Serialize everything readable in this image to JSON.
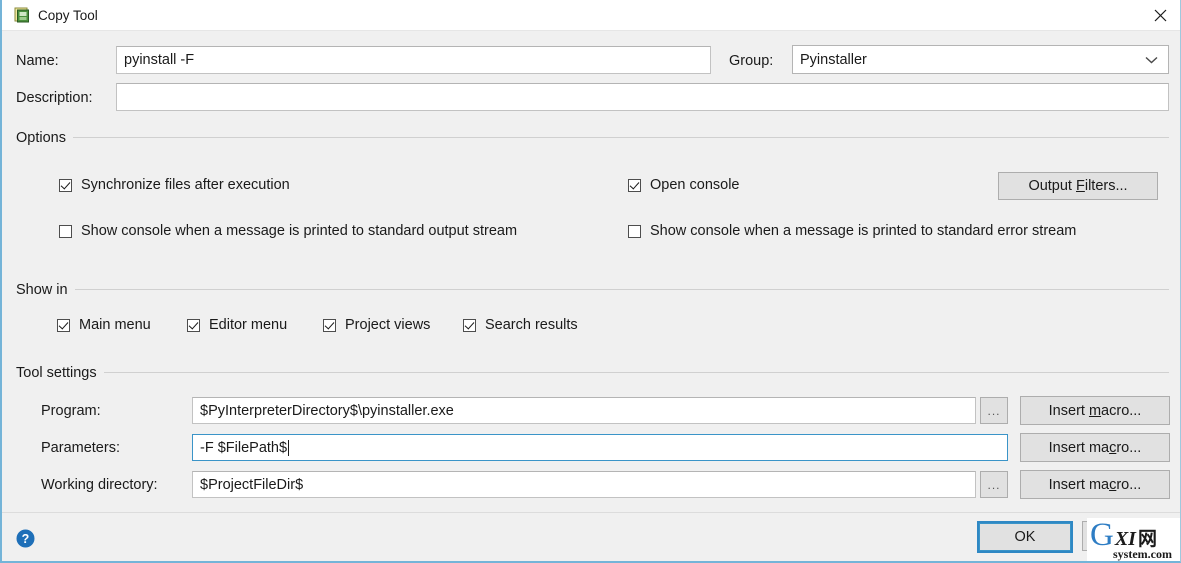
{
  "window": {
    "title": "Copy Tool",
    "icon": "copy-tool-icon",
    "close_label": "✕"
  },
  "form": {
    "name_label": "Name:",
    "name_value": "pyinstall -F",
    "group_label": "Group:",
    "group_value": "Pyinstaller",
    "description_label": "Description:",
    "description_value": ""
  },
  "options": {
    "title": "Options",
    "checkboxes": [
      {
        "label": "Synchronize files after execution",
        "checked": true
      },
      {
        "label": "Open console",
        "checked": true
      },
      {
        "label": "Show console when a message is printed to standard output stream",
        "checked": false
      },
      {
        "label": "Show console when a message is printed to standard error stream",
        "checked": false
      }
    ],
    "output_filters_button": "Output Filters...",
    "output_filters_mnemonic": "F"
  },
  "show_in": {
    "title": "Show in",
    "checkboxes": [
      {
        "label": "Main menu",
        "checked": true
      },
      {
        "label": "Editor menu",
        "checked": true
      },
      {
        "label": "Project views",
        "checked": true
      },
      {
        "label": "Search results",
        "checked": true
      }
    ]
  },
  "tool_settings": {
    "title": "Tool settings",
    "rows": [
      {
        "label": "Program:",
        "value": "$PyInterpreterDirectory$\\pyinstaller.exe",
        "focused": false,
        "has_browse": true,
        "browse_label": "...",
        "macro_button": "Insert macro...",
        "macro_mnemonic": "m"
      },
      {
        "label": "Parameters:",
        "value": "-F $FilePath$",
        "focused": true,
        "has_browse": false,
        "browse_label": "",
        "macro_button": "Insert macro...",
        "macro_mnemonic": "c"
      },
      {
        "label": "Working directory:",
        "value": "$ProjectFileDir$",
        "focused": false,
        "has_browse": true,
        "browse_label": "...",
        "macro_button": "Insert macro...",
        "macro_mnemonic": "c"
      }
    ]
  },
  "footer": {
    "help_icon": "help-icon",
    "help_glyph": "?",
    "ok_button": "OK"
  },
  "watermark": {
    "letter": "G",
    "middle": "XI",
    "cjk": "网",
    "domain": "system.com"
  },
  "colors": {
    "accent": "#3a94c8",
    "window_border": "#74b4d8",
    "dialog_bg": "#f0f0f0",
    "field_bg": "#ffffff",
    "button_bg": "#e1e1e1",
    "text": "#1a1a1a",
    "help_blue": "#1e6fb8",
    "watermark_blue": "#2e7dc4"
  }
}
